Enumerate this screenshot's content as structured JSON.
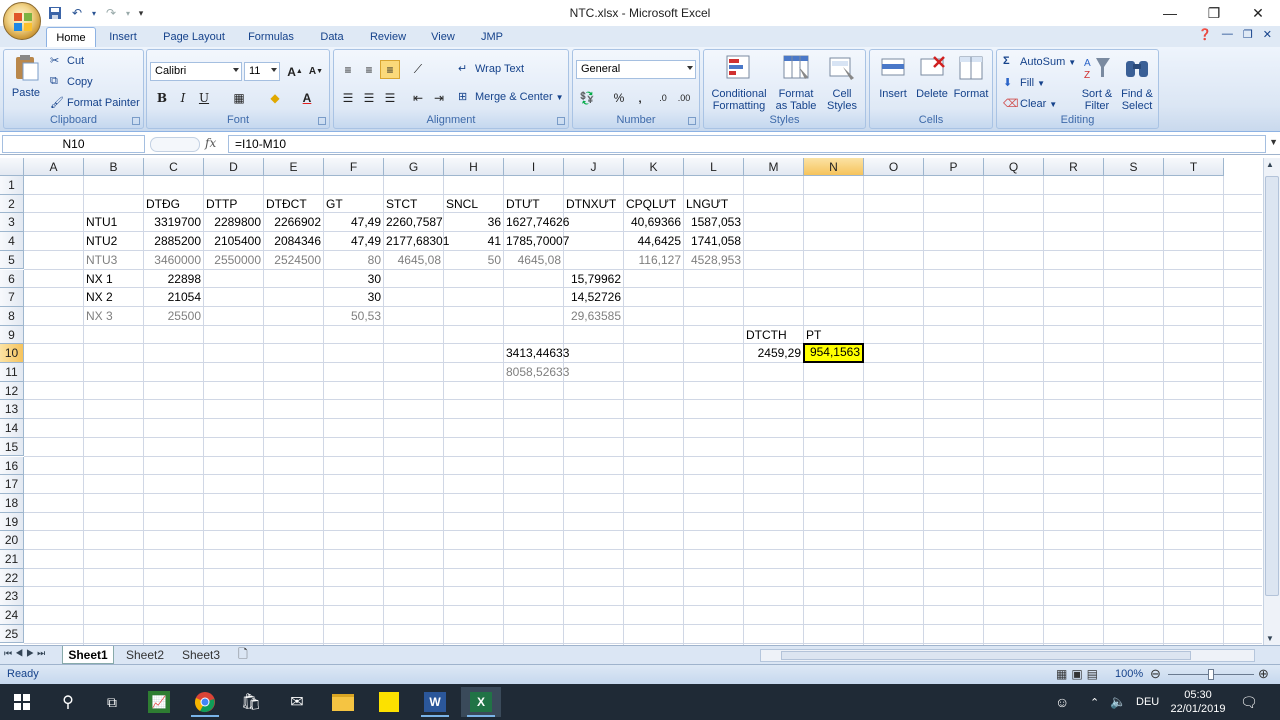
{
  "window": {
    "title": "NTC.xlsx - Microsoft Excel",
    "controls": {
      "minimize": "—",
      "restore": "❐",
      "close": "✕"
    }
  },
  "ribbon_tabs": [
    "Home",
    "Insert",
    "Page Layout",
    "Formulas",
    "Data",
    "Review",
    "View",
    "JMP"
  ],
  "ribbon": {
    "clipboard": {
      "paste": "Paste",
      "cut": "Cut",
      "copy": "Copy",
      "format_painter": "Format Painter",
      "label": "Clipboard"
    },
    "font": {
      "name": "Calibri",
      "size": "11",
      "label": "Font",
      "bold": "B",
      "italic": "I",
      "underline": "U"
    },
    "alignment": {
      "wrap_text": "Wrap Text",
      "merge_center": "Merge & Center",
      "label": "Alignment"
    },
    "number": {
      "format": "General",
      "label": "Number",
      "percent": "%",
      "comma": "‚"
    },
    "styles": {
      "conditional_1": "Conditional",
      "conditional_2": "Formatting",
      "format_table_1": "Format",
      "format_table_2": "as Table",
      "cell_styles_1": "Cell",
      "cell_styles_2": "Styles",
      "label": "Styles"
    },
    "cells": {
      "insert": "Insert",
      "delete": "Delete",
      "format": "Format",
      "label": "Cells"
    },
    "editing": {
      "autosum": "AutoSum",
      "fill": "Fill",
      "clear": "Clear",
      "sort_1": "Sort &",
      "sort_2": "Filter",
      "find_1": "Find &",
      "find_2": "Select",
      "label": "Editing"
    }
  },
  "formula_bar": {
    "name_box": "N10",
    "fx": "fx",
    "formula": "=I10-M10"
  },
  "columns": [
    "A",
    "B",
    "C",
    "D",
    "E",
    "F",
    "G",
    "H",
    "I",
    "J",
    "K",
    "L",
    "M",
    "N",
    "O",
    "P",
    "Q",
    "R",
    "S",
    "T"
  ],
  "selected_column": "N",
  "rows": [
    "1",
    "2",
    "3",
    "4",
    "5",
    "6",
    "7",
    "8",
    "9",
    "10",
    "11",
    "12",
    "13",
    "14",
    "15",
    "16",
    "17",
    "18",
    "19",
    "20",
    "21",
    "22",
    "23",
    "24",
    "25"
  ],
  "selected_row": "10",
  "cells": {
    "C2": "DTĐG",
    "D2": "DTTP",
    "E2": "DTĐCT",
    "F2": "GT",
    "G2": "STCT",
    "H2": "SNCL",
    "I2": "DTƯT",
    "J2": "DTNXƯT",
    "K2": "CPQLƯT",
    "L2": "LNGƯT",
    "B3": "NTU1",
    "C3": "3319700",
    "D3": "2289800",
    "E3": "2266902",
    "F3": "47,49",
    "G3": "2260,7587",
    "H3": "36",
    "I3": "1627,74626",
    "K3": "40,69366",
    "L3": "1587,053",
    "B4": "NTU2",
    "C4": "2885200",
    "D4": "2105400",
    "E4": "2084346",
    "F4": "47,49",
    "G4": "2177,68301",
    "H4": "41",
    "I4": "1785,70007",
    "K4": "44,6425",
    "L4": "1741,058",
    "B5": "NTU3",
    "C5": "3460000",
    "D5": "2550000",
    "E5": "2524500",
    "F5": "80",
    "G5": "4645,08",
    "H5": "50",
    "I5": "4645,08",
    "K5": "116,127",
    "L5": "4528,953",
    "B6": "NX 1",
    "C6": "22898",
    "F6": "30",
    "J6": "15,79962",
    "B7": "NX 2",
    "C7": "21054",
    "F7": "30",
    "J7": "14,52726",
    "B8": "NX 3",
    "C8": "25500",
    "F8": "50,53",
    "J8": "29,63585",
    "M9": "DTCTH",
    "N9": "PT",
    "I10": "3413,44633",
    "M10": "2459,29",
    "N10": "954,1563",
    "I11": "8058,52633"
  },
  "grey_rows": [
    "5",
    "8"
  ],
  "grey_cells": [
    "I11"
  ],
  "sheets": [
    "Sheet1",
    "Sheet2",
    "Sheet3"
  ],
  "active_sheet": "Sheet1",
  "status": {
    "ready": "Ready",
    "zoom": "100%"
  },
  "taskbar": {
    "time": "05:30",
    "date": "22/01/2019",
    "lang": "DEU"
  },
  "colors": {
    "selected_fill": "#ffff00",
    "accent": "#15428b"
  }
}
